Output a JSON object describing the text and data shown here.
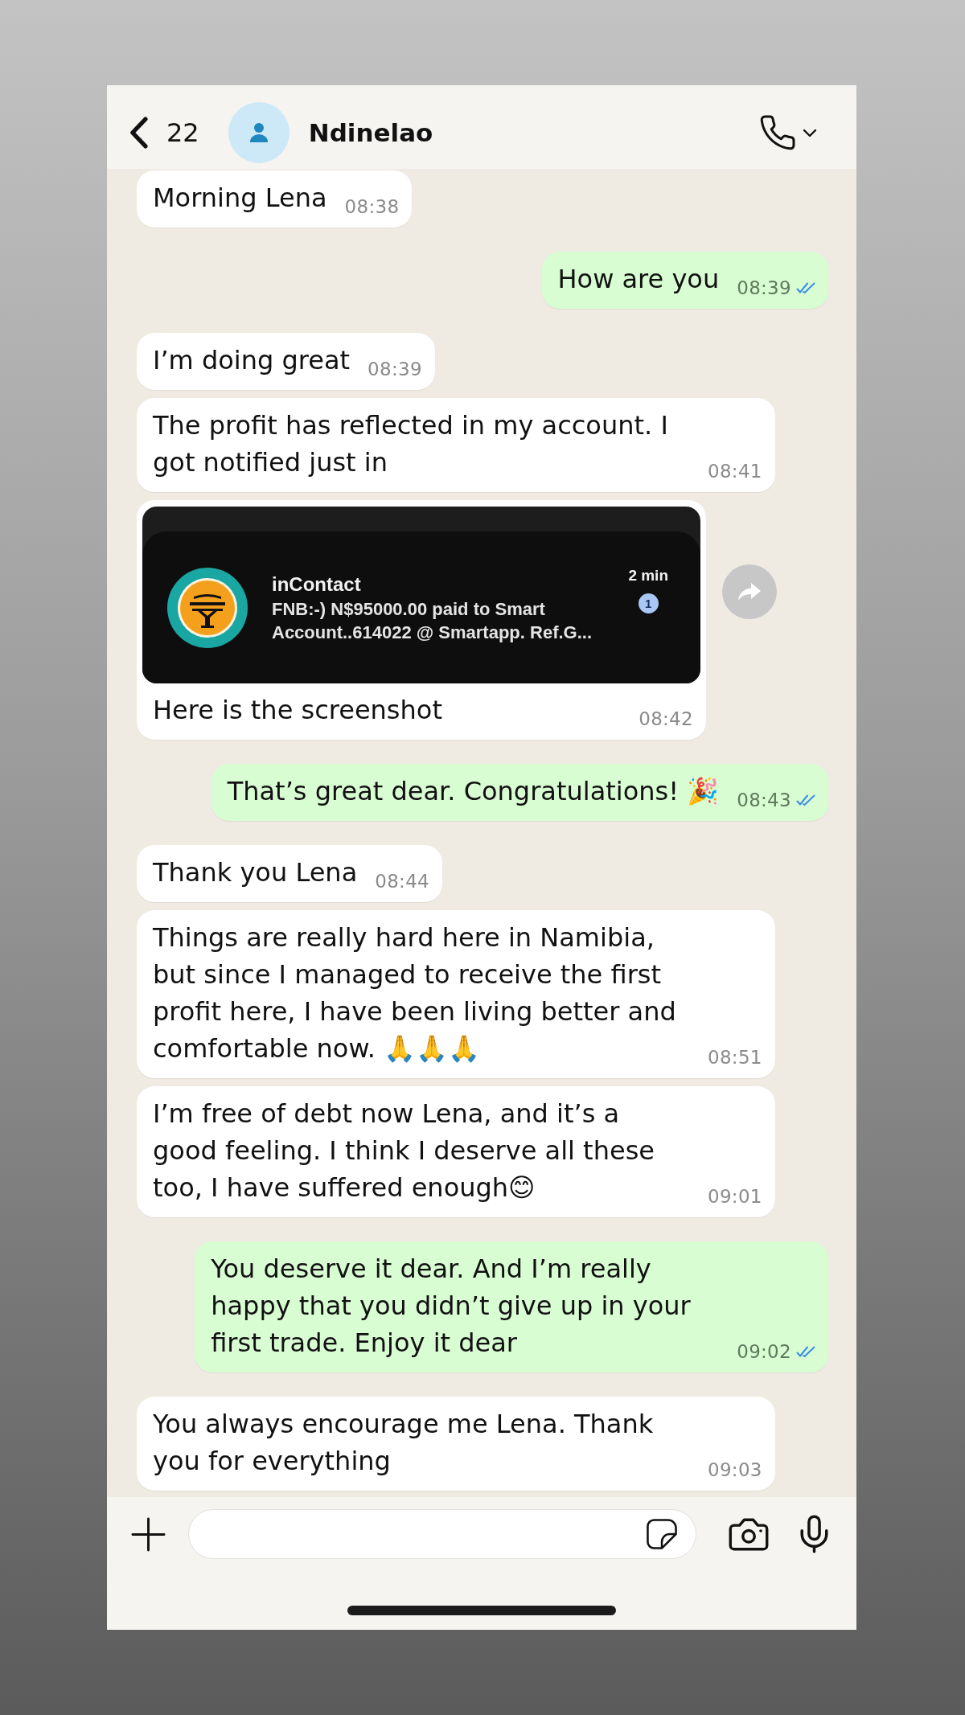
{
  "header": {
    "back_count": "22",
    "contact_name": "Ndinelao"
  },
  "messages": [
    {
      "kind": "text",
      "outgoing": false,
      "text": "Morning Lena",
      "time": "08:38"
    },
    {
      "kind": "text",
      "outgoing": true,
      "text": "How are you",
      "time": "08:39",
      "read": true
    },
    {
      "kind": "text",
      "outgoing": false,
      "text": "I’m doing great",
      "time": "08:39"
    },
    {
      "kind": "text",
      "outgoing": false,
      "text": "The profit has reflected in my account. I got notified just in",
      "time": "08:41"
    },
    {
      "kind": "media",
      "outgoing": false,
      "attachment": {
        "app": "inContact",
        "body": "FNB:-) N$95000.00 paid to Smart Account..614022 @ Smartapp. Ref.G...",
        "age": "2 min",
        "count": "1"
      },
      "text": "Here is the screenshot",
      "time": "08:42"
    },
    {
      "kind": "text",
      "outgoing": true,
      "text": "That’s great dear. Congratulations! 🎉",
      "time": "08:43",
      "read": true
    },
    {
      "kind": "text",
      "outgoing": false,
      "text": "Thank you Lena",
      "time": "08:44"
    },
    {
      "kind": "text",
      "outgoing": false,
      "text": "Things are really hard here in Namibia, but since I managed to receive the first profit here, I have been living better and comfortable now. 🙏🙏🙏",
      "time": "08:51"
    },
    {
      "kind": "text",
      "outgoing": false,
      "text": "I’m free of debt now Lena, and it’s a good feeling. I think I deserve all these too, I have suffered enough😊",
      "time": "09:01"
    },
    {
      "kind": "text",
      "outgoing": true,
      "text": "You deserve it dear. And I’m really happy that you didn’t give up in your first trade. Enjoy it dear",
      "time": "09:02",
      "read": true
    },
    {
      "kind": "text",
      "outgoing": false,
      "text": "You always encourage me Lena. Thank you for everything",
      "time": "09:03"
    }
  ]
}
